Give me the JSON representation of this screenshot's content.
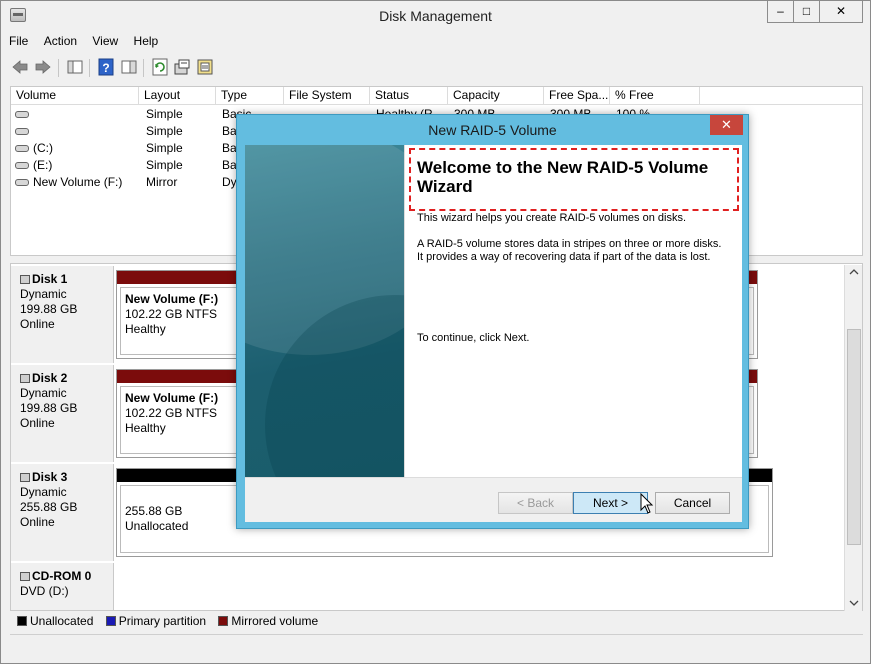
{
  "window": {
    "title": "Disk Management",
    "controls": {
      "minimize": "‒",
      "maximize": "□",
      "close": "✕"
    }
  },
  "menu": [
    "File",
    "Action",
    "View",
    "Help"
  ],
  "volume_list": {
    "columns": [
      "Volume",
      "Layout",
      "Type",
      "File System",
      "Status",
      "Capacity",
      "Free Spa...",
      "% Free"
    ],
    "rows": [
      {
        "volume": "",
        "layout": "Simple",
        "type": "Basic",
        "fs": "",
        "status": "Healthy (R",
        "capacity": "300 MB",
        "free": "300 MB",
        "pct": "100 %"
      },
      {
        "volume": "",
        "layout": "Simple",
        "type": "Bas",
        "fs": "",
        "status": "",
        "capacity": "",
        "free": "",
        "pct": ""
      },
      {
        "volume": "(C:)",
        "layout": "Simple",
        "type": "Bas",
        "fs": "",
        "status": "",
        "capacity": "",
        "free": "",
        "pct": ""
      },
      {
        "volume": "(E:)",
        "layout": "Simple",
        "type": "Bas",
        "fs": "",
        "status": "",
        "capacity": "",
        "free": "",
        "pct": ""
      },
      {
        "volume": "New Volume (F:)",
        "layout": "Mirror",
        "type": "Dy",
        "fs": "",
        "status": "",
        "capacity": "",
        "free": "",
        "pct": ""
      }
    ]
  },
  "disks": [
    {
      "name": "Disk 1",
      "kind": "Dynamic",
      "size": "199.88 GB",
      "state": "Online",
      "partition": {
        "title": "New Volume  (F:)",
        "detail": "102.22 GB NTFS",
        "status": "Healthy",
        "bar_color": "#7b0c0c"
      }
    },
    {
      "name": "Disk 2",
      "kind": "Dynamic",
      "size": "199.88 GB",
      "state": "Online",
      "partition": {
        "title": "New Volume  (F:)",
        "detail": "102.22 GB NTFS",
        "status": "Healthy",
        "bar_color": "#7b0c0c"
      }
    },
    {
      "name": "Disk 3",
      "kind": "Dynamic",
      "size": "255.88 GB",
      "state": "Online",
      "partition": {
        "title": "",
        "detail": "255.88 GB",
        "status": "Unallocated",
        "bar_color": "#000000"
      }
    },
    {
      "name": "CD-ROM 0",
      "kind": "DVD (D:)"
    }
  ],
  "legend": [
    {
      "label": "Unallocated",
      "color": "#000000"
    },
    {
      "label": "Primary partition",
      "color": "#1a1ab4"
    },
    {
      "label": "Mirrored volume",
      "color": "#7b0c0c"
    }
  ],
  "dialog": {
    "title": "New RAID-5 Volume",
    "close": "✕",
    "heading": "Welcome to the New RAID-5 Volume Wizard",
    "intro": "This wizard helps you create RAID-5 volumes on disks.",
    "desc_line1": "A RAID-5 volume stores data in stripes on three or more disks.",
    "desc_line2": "It provides a way of recovering data if part of the data is lost.",
    "continue_text": "To continue, click Next.",
    "buttons": {
      "back": "< Back",
      "next": "Next >",
      "cancel": "Cancel"
    }
  }
}
